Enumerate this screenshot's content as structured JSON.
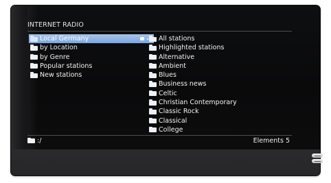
{
  "header": {
    "title": "INTERNET RADIO"
  },
  "left_list": {
    "items": [
      {
        "label": "Local Germany",
        "selected": true
      },
      {
        "label": "by Location"
      },
      {
        "label": "by Genre"
      },
      {
        "label": "Popular stations"
      },
      {
        "label": "New stations"
      }
    ]
  },
  "right_list": {
    "items": [
      {
        "label": "All stations"
      },
      {
        "label": "Highlighted stations"
      },
      {
        "label": "Alternative"
      },
      {
        "label": "Ambient"
      },
      {
        "label": "Blues"
      },
      {
        "label": "Business news"
      },
      {
        "label": "Celtic"
      },
      {
        "label": "Christian Contemporary"
      },
      {
        "label": "Classic Rock"
      },
      {
        "label": "Classical"
      },
      {
        "label": "College"
      }
    ]
  },
  "footer": {
    "path": ":/",
    "elements_label": "Elements 5"
  },
  "colors": {
    "selection": "#8fb3e4",
    "screen_background": "#0c0c0d",
    "text": "#f2f2f2"
  },
  "icons": {
    "folder": "folder-icon",
    "selected_extra": [
      "note-icon",
      "loading-icon"
    ],
    "logos": [
      "hd-logo-icon",
      "dolby-logo-icon"
    ]
  }
}
